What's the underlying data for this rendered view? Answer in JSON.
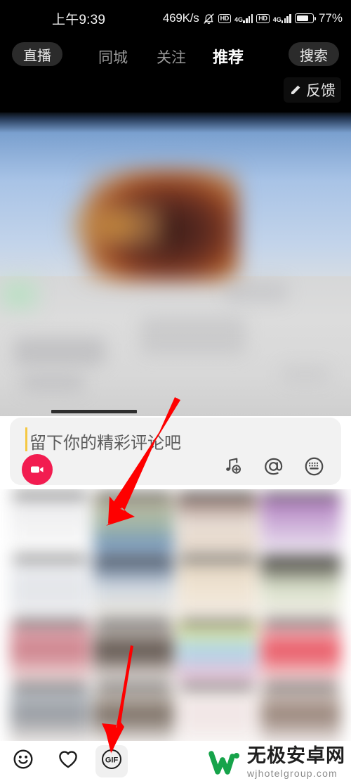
{
  "status_bar": {
    "time": "上午9:39",
    "net_speed": "469K/s",
    "mute_icon": "bell-muted-icon",
    "hd_label_1": "HD",
    "network_label_1": "4G",
    "hd_label_2": "HD",
    "network_label_2": "4G",
    "battery_percent": "77%",
    "battery_level": 77
  },
  "top_nav": {
    "live_label": "直播",
    "search_label": "搜索",
    "tabs": [
      {
        "label": "同城",
        "active": false,
        "badge": false
      },
      {
        "label": "关注",
        "active": false,
        "badge": true
      },
      {
        "label": "推荐",
        "active": true,
        "badge": false
      }
    ],
    "badge_color": "#f2b01e",
    "pill_color": "#2b2b2b",
    "active_color": "#ffffff",
    "inactive_color": "#9a9a9a"
  },
  "feedback": {
    "label": "反馈",
    "icon": "pencil-icon"
  },
  "video_feed": {
    "description": "blurred video post",
    "drag_handle": "drag-handle"
  },
  "comment_input": {
    "placeholder": "留下你的精彩评论吧",
    "caret_color": "#f5c842",
    "video_button": {
      "icon": "video-camera-icon",
      "color": "#f21c50"
    },
    "actions": [
      {
        "name": "music-add-icon",
        "label": "音乐"
      },
      {
        "name": "at-mention-icon",
        "label": "@"
      },
      {
        "name": "keyboard-icon",
        "label": "键盘"
      }
    ]
  },
  "gif_panel": {
    "selected": true,
    "cells": [
      {
        "top": "#e8e8ea",
        "mid": "#f1f1f2",
        "bottom": "#fafafa",
        "band": "#2a2a2a"
      },
      {
        "top": "#b8a88f",
        "mid": "#9fb4a0",
        "bottom": "#5e87bd",
        "band": "#1a1a1a"
      },
      {
        "top": "#7a5a52",
        "mid": "#e8ddd4",
        "bottom": "#e3d3c2",
        "band": "#1a1a1a"
      },
      {
        "top": "#9a5fa8",
        "mid": "#c9a8d6",
        "bottom": "#eae2ee",
        "band": "#2a2a2a"
      },
      {
        "top": "#f2f2f4",
        "mid": "#e0e3e8",
        "bottom": "#ececee",
        "band": "#3a3a3a"
      },
      {
        "top": "#2c4566",
        "mid": "#cfd8e2",
        "bottom": "#e8e2d8",
        "band": "#1a1a1a"
      },
      {
        "top": "#d8c9b4",
        "mid": "#efe2cf",
        "bottom": "#f0e8de",
        "band": "#1a1a1a"
      },
      {
        "top": "#2a2520",
        "mid": "#d8e0c8",
        "bottom": "#eeeae2",
        "band": "#1a1a1a"
      },
      {
        "top": "#e5b8c0",
        "mid": "#c9747f",
        "bottom": "#f0dcdc",
        "band": "#2a2a2a"
      },
      {
        "top": "#ece7e2",
        "mid": "#4a3d35",
        "bottom": "#efe8e4",
        "band": "#1a1a1a"
      },
      {
        "top": "#f0e87a",
        "mid": "#a8d4ea",
        "bottom": "#f2b8d0",
        "band": "#2a2a2a"
      },
      {
        "top": "#f2e2e4",
        "mid": "#e8414f",
        "bottom": "#f2dede",
        "band": "#1a1a1a"
      },
      {
        "top": "#cfd4da",
        "mid": "#8a8f96",
        "bottom": "#efe8e4",
        "band": "#2a2a2a"
      },
      {
        "top": "#f0eae4",
        "mid": "#6a5c50",
        "bottom": "#f2eeec",
        "band": "#1a1a1a"
      },
      {
        "top": "#f4eeea",
        "mid": "#f0e4e4",
        "bottom": "#f6f2f0",
        "band": "#2a2a2a"
      },
      {
        "top": "#efe4e0",
        "mid": "#8a7468",
        "bottom": "#f2eceb",
        "band": "#1a1a1a"
      }
    ]
  },
  "bottom_toolbar": {
    "tools": [
      {
        "name": "emoji-icon",
        "label": "表情",
        "selected": false
      },
      {
        "name": "heart-icon",
        "label": "收藏",
        "selected": false
      },
      {
        "name": "gif-icon",
        "label": "GIF",
        "selected": true
      }
    ],
    "gif_label": "GIF"
  },
  "watermark": {
    "cn": "无极安卓网",
    "en": "wjhotelgroup.com",
    "logo_color": "#16a34a"
  },
  "annotations": {
    "arrow_color": "#fe0000",
    "arrows": [
      {
        "name": "arrow-to-gif-grid"
      },
      {
        "name": "arrow-to-gif-button"
      }
    ]
  }
}
